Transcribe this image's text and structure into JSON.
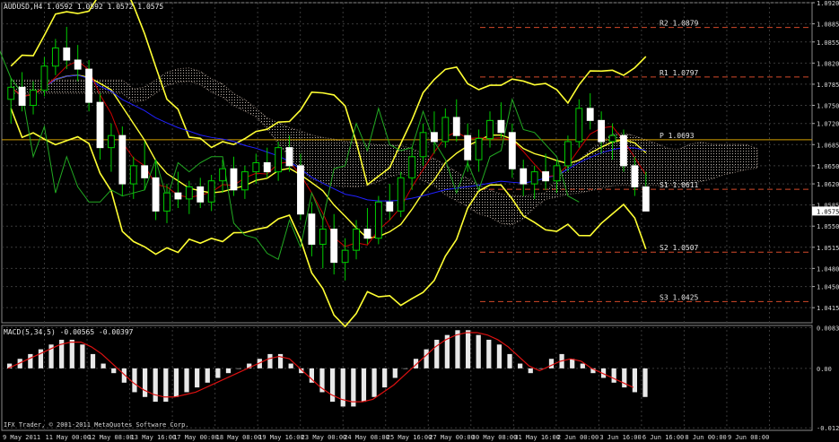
{
  "chart_data": {
    "type": "candlestick",
    "symbol_header": "AUDUSD,H4  1.0592 1.0592 1.0572 1.0575",
    "current_price_label": "1.0575",
    "x_tick_labels": [
      "9 May 2011",
      "11 May 00:00",
      "12 May 08:00",
      "13 May 16:00",
      "17 May 00:00",
      "18 May 08:00",
      "19 May 16:00",
      "23 May 00:00",
      "24 May 08:00",
      "25 May 16:00",
      "27 May 00:00",
      "30 May 08:00",
      "31 May 16:00",
      "2 Jun 00:00",
      "3 Jun 16:00",
      "6 Jun 16:00",
      "8 Jun 00:00",
      "9 Jun 08:00"
    ],
    "price_axis": {
      "range": [
        1.039,
        1.092
      ],
      "tick_labels": [
        "1.0920",
        "1.0885",
        "1.0855",
        "1.0820",
        "1.0785",
        "1.0750",
        "1.0720",
        "1.0685",
        "1.0650",
        "1.0620",
        "1.0585",
        "1.0550",
        "1.0515",
        "1.0480",
        "1.0450",
        "1.0415"
      ]
    },
    "pivot_levels": [
      {
        "label": "R2  1.0879",
        "value": 1.0879,
        "color": "#d44a2a"
      },
      {
        "label": "R1  1.0797",
        "value": 1.0797,
        "color": "#d44a2a"
      },
      {
        "label": "P  1.0693",
        "value": 1.0693,
        "color": "#d4a000"
      },
      {
        "label": "S1  1.0611",
        "value": 1.0611,
        "color": "#d44a2a"
      },
      {
        "label": "S2  1.0507",
        "value": 1.0507,
        "color": "#d44a2a"
      },
      {
        "label": "S3  1.0425",
        "value": 1.0425,
        "color": "#d44a2a"
      }
    ],
    "candles": [
      [
        1.076,
        1.0795,
        1.072,
        1.078
      ],
      [
        1.078,
        1.0805,
        1.074,
        1.075
      ],
      [
        1.075,
        1.079,
        1.0735,
        1.0775
      ],
      [
        1.0775,
        1.083,
        1.0765,
        1.0815
      ],
      [
        1.0815,
        1.086,
        1.08,
        1.0845
      ],
      [
        1.0845,
        1.088,
        1.081,
        1.0825
      ],
      [
        1.0825,
        1.085,
        1.079,
        1.081
      ],
      [
        1.081,
        1.0825,
        1.074,
        1.0755
      ],
      [
        1.0755,
        1.077,
        1.066,
        1.068
      ],
      [
        1.068,
        1.072,
        1.064,
        1.07
      ],
      [
        1.07,
        1.0715,
        1.06,
        1.062
      ],
      [
        1.062,
        1.0665,
        1.0595,
        1.065
      ],
      [
        1.065,
        1.069,
        1.061,
        1.063
      ],
      [
        1.063,
        1.066,
        1.056,
        1.0575
      ],
      [
        1.0575,
        1.062,
        1.0555,
        1.0605
      ],
      [
        1.0605,
        1.064,
        1.058,
        1.0595
      ],
      [
        1.0595,
        1.0625,
        1.057,
        1.0615
      ],
      [
        1.0615,
        1.063,
        1.058,
        1.059
      ],
      [
        1.059,
        1.0635,
        1.0575,
        1.0625
      ],
      [
        1.0625,
        1.066,
        1.0605,
        1.0645
      ],
      [
        1.0645,
        1.0665,
        1.06,
        1.061
      ],
      [
        1.061,
        1.065,
        1.0595,
        1.064
      ],
      [
        1.064,
        1.067,
        1.062,
        1.0655
      ],
      [
        1.0655,
        1.068,
        1.063,
        1.064
      ],
      [
        1.064,
        1.069,
        1.0625,
        1.068
      ],
      [
        1.068,
        1.07,
        1.064,
        1.065
      ],
      [
        1.065,
        1.067,
        1.056,
        1.057
      ],
      [
        1.057,
        1.059,
        1.05,
        1.052
      ],
      [
        1.052,
        1.056,
        1.048,
        1.0545
      ],
      [
        1.0545,
        1.057,
        1.047,
        1.049
      ],
      [
        1.049,
        1.053,
        1.046,
        1.051
      ],
      [
        1.051,
        1.056,
        1.0495,
        1.0545
      ],
      [
        1.0545,
        1.058,
        1.052,
        1.053
      ],
      [
        1.053,
        1.06,
        1.052,
        1.059
      ],
      [
        1.059,
        1.062,
        1.056,
        1.0575
      ],
      [
        1.0575,
        1.064,
        1.0565,
        1.063
      ],
      [
        1.063,
        1.068,
        1.061,
        1.0665
      ],
      [
        1.0665,
        1.072,
        1.065,
        1.0705
      ],
      [
        1.0705,
        1.074,
        1.067,
        1.069
      ],
      [
        1.069,
        1.0745,
        1.068,
        1.073
      ],
      [
        1.073,
        1.076,
        1.069,
        1.07
      ],
      [
        1.07,
        1.072,
        1.064,
        1.066
      ],
      [
        1.066,
        1.071,
        1.064,
        1.0695
      ],
      [
        1.0695,
        1.074,
        1.068,
        1.0725
      ],
      [
        1.0725,
        1.0755,
        1.0695,
        1.0705
      ],
      [
        1.0705,
        1.072,
        1.063,
        1.0645
      ],
      [
        1.0645,
        1.066,
        1.06,
        1.062
      ],
      [
        1.062,
        1.065,
        1.0595,
        1.064
      ],
      [
        1.064,
        1.067,
        1.061,
        1.0625
      ],
      [
        1.0625,
        1.066,
        1.0605,
        1.065
      ],
      [
        1.065,
        1.07,
        1.064,
        1.069
      ],
      [
        1.069,
        1.076,
        1.068,
        1.0745
      ],
      [
        1.0745,
        1.077,
        1.071,
        1.0725
      ],
      [
        1.0725,
        1.074,
        1.067,
        1.069
      ],
      [
        1.069,
        1.072,
        1.066,
        1.07
      ],
      [
        1.07,
        1.071,
        1.064,
        1.065
      ],
      [
        1.065,
        1.0665,
        1.06,
        1.0615
      ],
      [
        1.0615,
        1.064,
        1.058,
        1.0575
      ]
    ],
    "macd": {
      "label": "MACD(5,34,5) -0.00565 -0.00397",
      "axis_range": [
        -0.013,
        0.009
      ],
      "axis_tick_labels": [
        "0.00839",
        "0.00",
        "-0.01252"
      ],
      "histogram": [
        0.001,
        0.002,
        0.003,
        0.004,
        0.005,
        0.006,
        0.006,
        0.005,
        0.003,
        0.001,
        -0.001,
        -0.003,
        -0.005,
        -0.006,
        -0.007,
        -0.007,
        -0.006,
        -0.005,
        -0.004,
        -0.003,
        -0.002,
        -0.001,
        0.0,
        0.001,
        0.002,
        0.003,
        0.003,
        0.001,
        -0.001,
        -0.003,
        -0.005,
        -0.007,
        -0.008,
        -0.008,
        -0.007,
        -0.006,
        -0.004,
        -0.002,
        0.0,
        0.002,
        0.004,
        0.006,
        0.007,
        0.008,
        0.008,
        0.007,
        0.006,
        0.005,
        0.003,
        0.001,
        -0.001,
        0.0,
        0.002,
        0.003,
        0.002,
        0.001,
        -0.001,
        -0.002,
        -0.003,
        -0.004,
        -0.005,
        -0.006
      ],
      "signal": [
        0.0,
        0.001,
        0.002,
        0.003,
        0.004,
        0.005,
        0.0055,
        0.0055,
        0.0045,
        0.003,
        0.001,
        -0.001,
        -0.003,
        -0.0045,
        -0.0055,
        -0.006,
        -0.006,
        -0.0055,
        -0.005,
        -0.004,
        -0.003,
        -0.002,
        -0.001,
        0.0,
        0.001,
        0.002,
        0.0025,
        0.002,
        0.0,
        -0.002,
        -0.004,
        -0.0055,
        -0.0065,
        -0.007,
        -0.007,
        -0.0065,
        -0.005,
        -0.0035,
        -0.0015,
        0.0005,
        0.0025,
        0.0045,
        0.006,
        0.007,
        0.0075,
        0.0075,
        0.007,
        0.006,
        0.0045,
        0.0025,
        0.0005,
        -0.0005,
        0.0005,
        0.0015,
        0.002,
        0.0015,
        0.0,
        -0.001,
        -0.002,
        -0.003,
        -0.004
      ]
    },
    "footer_text": "IFX Trader, © 2001-2011 MetaQuotes Software Corp."
  },
  "colors": {
    "background": "#000000",
    "grid": "#3a3a3a",
    "bull_candle": "#f2f2d0",
    "bear_candle": "#ffffff",
    "wick": "#00cc00",
    "bollinger": "#ffff33",
    "moving_avg_blue": "#2020ff",
    "moving_avg_red": "#cc0000",
    "lagging_span": "#22aa22",
    "cloud": "#b0a8a0",
    "macd_hist": "#e8e8e8",
    "macd_signal": "#dd1111"
  }
}
